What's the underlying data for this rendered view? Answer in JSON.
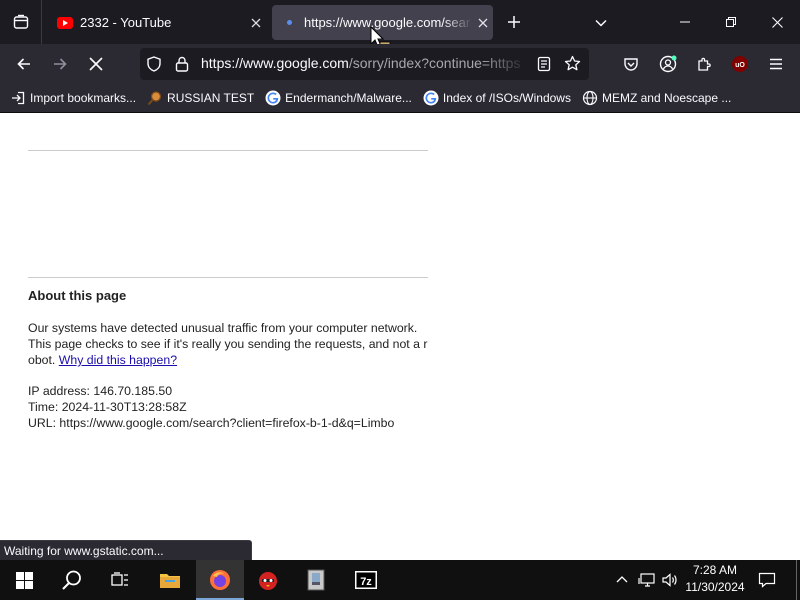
{
  "tabs": [
    {
      "title": "2332 - YouTube",
      "icon": "youtube-icon"
    },
    {
      "title": "https://www.google.com/sear",
      "icon": "loading-dot-icon",
      "active": true
    }
  ],
  "urlbar": {
    "url_main": "https://www.google.com",
    "url_rest": "/sorry/index?continue=https"
  },
  "bookmarks": [
    {
      "label": "Import bookmarks...",
      "icon": "import-icon"
    },
    {
      "label": "RUSSIAN TEST",
      "icon": "magnifier-icon"
    },
    {
      "label": "Endermanch/Malware...",
      "icon": "google-icon"
    },
    {
      "label": "Index of /ISOs/Windows",
      "icon": "google-icon"
    },
    {
      "label": "MEMZ and Noescape ...",
      "icon": "globe-icon"
    }
  ],
  "page": {
    "about_title": "About this page",
    "paragraph": "Our systems have detected unusual traffic from your computer network. This page checks to see if it's really you sending the requests, and not a robot.",
    "why_link": "Why did this happen?",
    "ip_line": "IP address: 146.70.185.50",
    "time_line": "Time: 2024-11-30T13:28:58Z",
    "url_line": "URL: https://www.google.com/search?client=firefox-b-1-d&q=Limbo"
  },
  "status": {
    "text": "Waiting for www.gstatic.com..."
  },
  "taskbar": {
    "time": "7:28 AM",
    "date": "11/30/2024"
  },
  "colors": {
    "tabbar_bg": "#1c1b22",
    "toolbar_bg": "#2b2a33",
    "link": "#1a0dab",
    "taskbar_bg": "#101010"
  }
}
